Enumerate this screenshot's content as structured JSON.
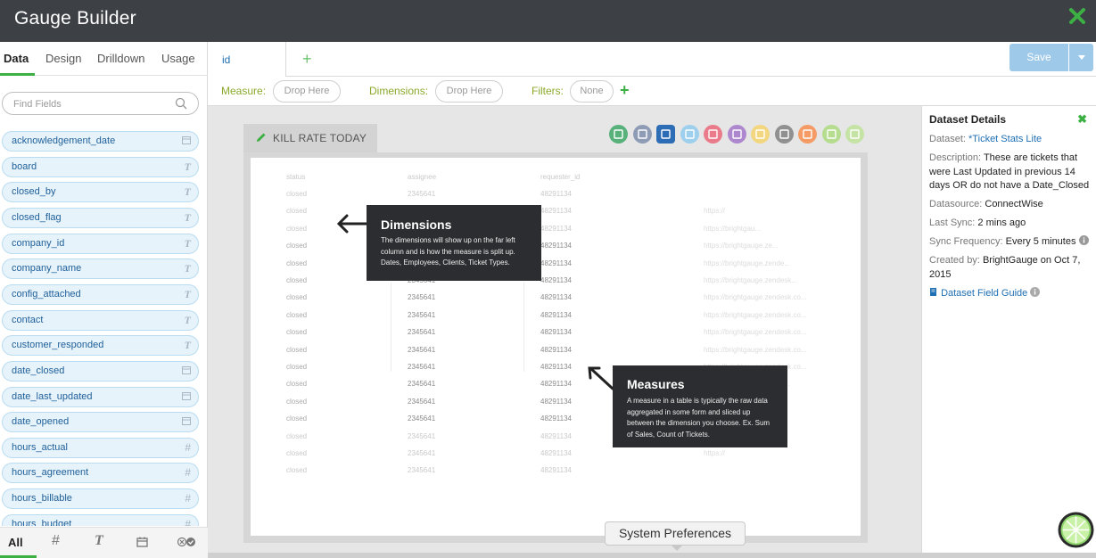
{
  "app": {
    "title": "Gauge Builder",
    "close_icon": "close-x-icon"
  },
  "sidebar": {
    "tabs": [
      {
        "label": "Data",
        "active": true
      },
      {
        "label": "Design",
        "active": false
      },
      {
        "label": "Drilldown",
        "active": false
      },
      {
        "label": "Usage",
        "active": false
      }
    ],
    "search_placeholder": "Find Fields",
    "fields": [
      {
        "name": "acknowledgement_date",
        "type": "date"
      },
      {
        "name": "board",
        "type": "text"
      },
      {
        "name": "closed_by",
        "type": "text"
      },
      {
        "name": "closed_flag",
        "type": "text"
      },
      {
        "name": "company_id",
        "type": "text"
      },
      {
        "name": "company_name",
        "type": "text"
      },
      {
        "name": "config_attached",
        "type": "text"
      },
      {
        "name": "contact",
        "type": "text"
      },
      {
        "name": "customer_responded",
        "type": "text"
      },
      {
        "name": "date_closed",
        "type": "date"
      },
      {
        "name": "date_last_updated",
        "type": "date"
      },
      {
        "name": "date_opened",
        "type": "date"
      },
      {
        "name": "hours_actual",
        "type": "number"
      },
      {
        "name": "hours_agreement",
        "type": "number"
      },
      {
        "name": "hours_billable",
        "type": "number"
      },
      {
        "name": "hours_budget",
        "type": "number"
      }
    ],
    "bottom_filters": {
      "all": "All",
      "number": "#",
      "text": "T"
    }
  },
  "tabs": {
    "active_tab": "id",
    "add_icon": "plus-icon"
  },
  "toolbar": {
    "save_label": "Save"
  },
  "builder": {
    "measure_label": "Measure:",
    "measure_placeholder": "Drop Here",
    "dimensions_label": "Dimensions:",
    "dimensions_placeholder": "Drop Here",
    "filters_label": "Filters:",
    "filters_value": "None"
  },
  "gauge": {
    "name": "KILL RATE TODAY",
    "viz_types": [
      {
        "name": "funnel",
        "color": "#58b07a"
      },
      {
        "name": "camera",
        "color": "#8f9cb6"
      },
      {
        "name": "table",
        "color": "#2d6db5",
        "active": true
      },
      {
        "name": "bar",
        "color": "#9ed0ee"
      },
      {
        "name": "line",
        "color": "#ea7b8a"
      },
      {
        "name": "list",
        "color": "#ae88cf"
      },
      {
        "name": "smiley",
        "color": "#f3d780"
      },
      {
        "name": "number",
        "color": "#909090"
      },
      {
        "name": "gauge",
        "color": "#f59c66"
      },
      {
        "name": "split",
        "color": "#b5dc8f"
      },
      {
        "name": "trophy",
        "color": "#c6e3a6"
      }
    ]
  },
  "preview": {
    "columns": [
      "status",
      "assignee",
      "requester_id"
    ],
    "rows": [
      {
        "status": "closed",
        "assignee": "2345641",
        "requester_id": "48291134",
        "url": ""
      },
      {
        "status": "closed",
        "assignee": "2345641",
        "requester_id": "48291134",
        "url": "https://"
      },
      {
        "status": "closed",
        "assignee": "2345641",
        "requester_id": "48291134",
        "url": "https://brightgau..."
      },
      {
        "status": "closed",
        "assignee": "2345641",
        "requester_id": "48291134",
        "url": "https://brightgauge.ze..."
      },
      {
        "status": "closed",
        "assignee": "2345641",
        "requester_id": "48291134",
        "url": "https://brightgauge.zende..."
      },
      {
        "status": "closed",
        "assignee": "2345641",
        "requester_id": "48291134",
        "url": "https://brightgauge.zendesk..."
      },
      {
        "status": "closed",
        "assignee": "2345641",
        "requester_id": "48291134",
        "url": "https://brightgauge.zendesk.co..."
      },
      {
        "status": "closed",
        "assignee": "2345641",
        "requester_id": "48291134",
        "url": "https://brightgauge.zendesk.co..."
      },
      {
        "status": "closed",
        "assignee": "2345641",
        "requester_id": "48291134",
        "url": "https://brightgauge.zendesk.co..."
      },
      {
        "status": "closed",
        "assignee": "2345641",
        "requester_id": "48291134",
        "url": "https://brightgauge.zendesk.co..."
      },
      {
        "status": "closed",
        "assignee": "2345641",
        "requester_id": "48291134",
        "url": "https://brightgauge.zendesk.co..."
      },
      {
        "status": "closed",
        "assignee": "2345641",
        "requester_id": "48291134",
        "url": "https://brightgauge.zende..."
      },
      {
        "status": "closed",
        "assignee": "2345641",
        "requester_id": "48291134",
        "url": "https://brightgauge.ze..."
      },
      {
        "status": "closed",
        "assignee": "2345641",
        "requester_id": "48291134",
        "url": "https://brightg..."
      },
      {
        "status": "closed",
        "assignee": "2345641",
        "requester_id": "48291134",
        "url": "https://"
      },
      {
        "status": "closed",
        "assignee": "2345641",
        "requester_id": "48291134",
        "url": "https://"
      },
      {
        "status": "closed",
        "assignee": "2345641",
        "requester_id": "48291134",
        "url": ""
      }
    ]
  },
  "tooltips": {
    "dimensions": {
      "title": "Dimensions",
      "body": "The dimensions will show up on the far left column and is how the measure is split up. Dates, Employees, Clients, Ticket Types."
    },
    "measures": {
      "title": "Measures",
      "body": "A measure in a table is typically the raw data aggregated in some form and sliced up between the dimension you choose. Ex. Sum of Sales, Count of Tickets."
    }
  },
  "dataset": {
    "title": "Dataset Details",
    "dataset_label": "Dataset:",
    "dataset_value": "*Ticket Stats Lite",
    "description_label": "Description:",
    "description_value": "These are tickets that were Last Updated in previous 14 days OR do not have a Date_Closed",
    "datasource_label": "Datasource:",
    "datasource_value": "ConnectWise",
    "last_sync_label": "Last Sync:",
    "last_sync_value": "2 mins ago",
    "sync_freq_label": "Sync Frequency:",
    "sync_freq_value": "Every 5 minutes",
    "created_label": "Created by:",
    "created_value": "BrightGauge on Oct 7, 2015",
    "field_guide": "Dataset Field Guide"
  },
  "system_tooltip": "System Preferences",
  "colors": {
    "accent_green": "#3cb043",
    "header": "#3d4145",
    "field_blue": "#1f5f99",
    "save_blue": "#9fc9e8"
  }
}
